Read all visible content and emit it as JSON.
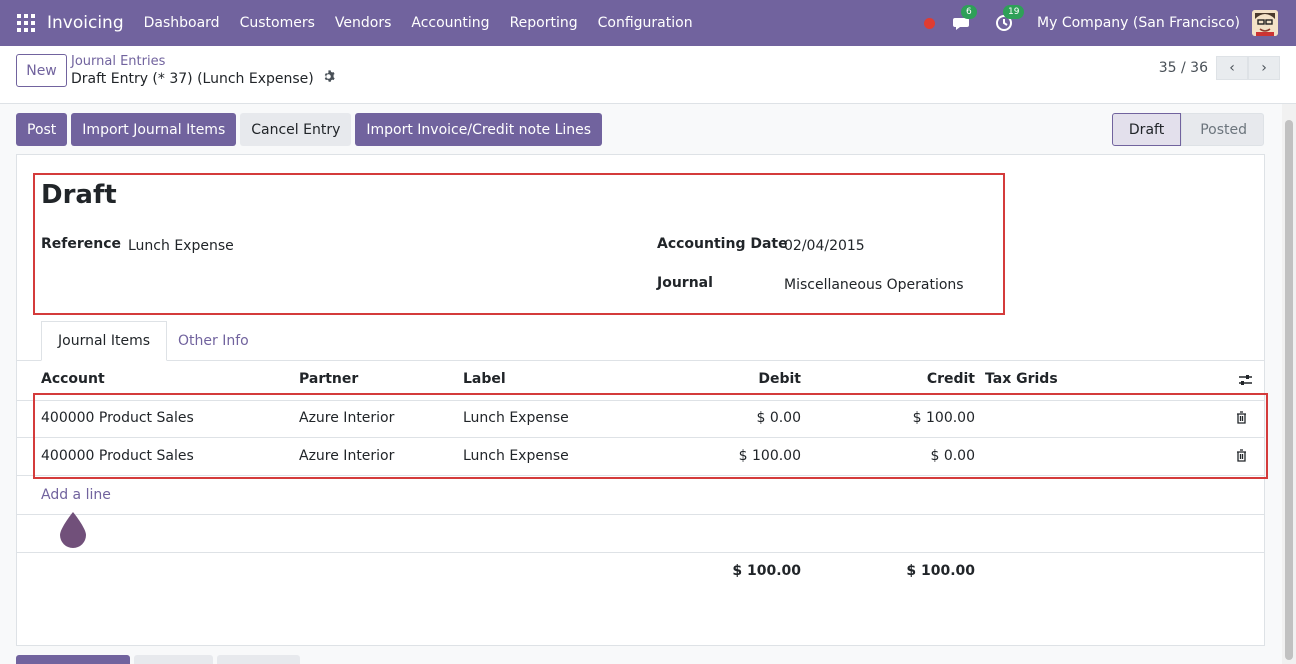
{
  "navbar": {
    "app_name": "Invoicing",
    "menu": [
      "Dashboard",
      "Customers",
      "Vendors",
      "Accounting",
      "Reporting",
      "Configuration"
    ],
    "messages_badge": "6",
    "activities_badge": "19",
    "company": "My Company (San Francisco)"
  },
  "control": {
    "new_label": "New",
    "breadcrumb_parent": "Journal Entries",
    "breadcrumb_current": "Draft Entry (* 37) (Lunch Expense)",
    "pager": "35 / 36"
  },
  "actions": {
    "post": "Post",
    "import_items": "Import Journal Items",
    "cancel_entry": "Cancel Entry",
    "import_invoice": "Import Invoice/Credit note Lines"
  },
  "status": {
    "active": "Draft",
    "next": "Posted"
  },
  "form": {
    "state_title": "Draft",
    "reference_label": "Reference",
    "reference_value": "Lunch Expense",
    "date_label": "Accounting Date",
    "date_value": "02/04/2015",
    "journal_label": "Journal",
    "journal_value": "Miscellaneous Operations"
  },
  "tabs": {
    "items": "Journal Items",
    "other": "Other Info"
  },
  "table": {
    "headers": {
      "account": "Account",
      "partner": "Partner",
      "label": "Label",
      "debit": "Debit",
      "credit": "Credit",
      "tax_grids": "Tax Grids"
    },
    "rows": [
      {
        "account": "400000 Product Sales",
        "partner": "Azure Interior",
        "label": "Lunch Expense",
        "debit": "$ 0.00",
        "credit": "$ 100.00"
      },
      {
        "account": "400000 Product Sales",
        "partner": "Azure Interior",
        "label": "Lunch Expense",
        "debit": "$ 100.00",
        "credit": "$ 0.00"
      }
    ],
    "add_line": "Add a line",
    "total_debit": "$ 100.00",
    "total_credit": "$ 100.00"
  },
  "colors": {
    "brand": "#71639e",
    "highlight": "#d43b3b",
    "badge": "#2ea058",
    "record": "#e03c31"
  }
}
